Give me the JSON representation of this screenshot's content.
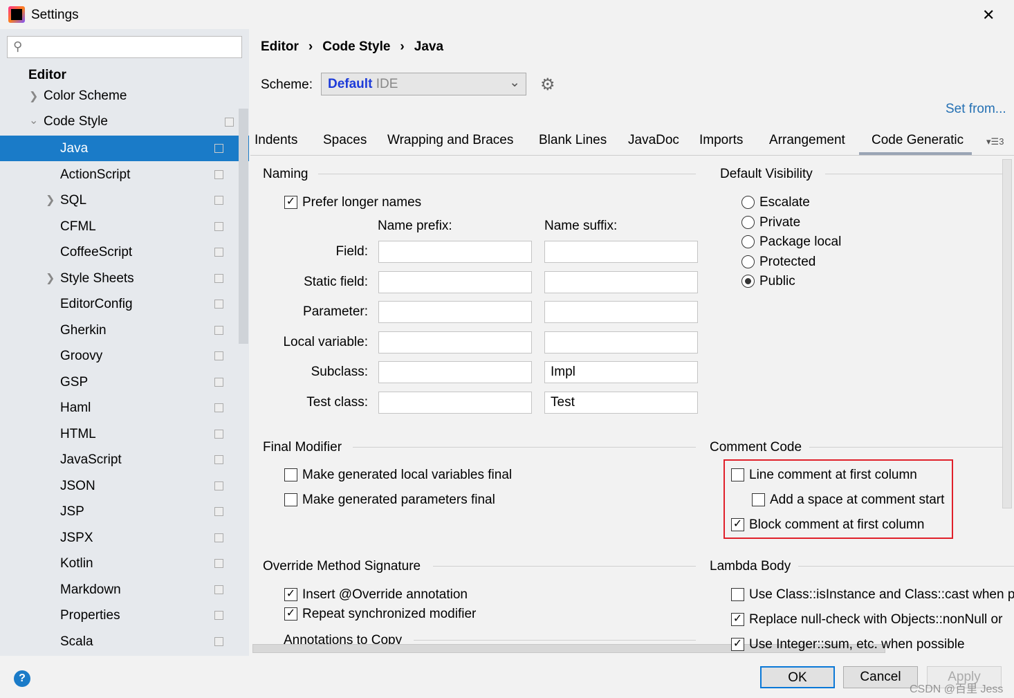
{
  "window": {
    "title": "Settings",
    "close": "✕"
  },
  "search": {
    "placeholder": "",
    "value": ""
  },
  "sidebar": {
    "section": "Editor",
    "color_scheme": "Color Scheme",
    "code_style": "Code Style",
    "items": [
      {
        "label": "Java",
        "selected": true
      },
      {
        "label": "ActionScript"
      },
      {
        "label": "SQL",
        "expandable": true
      },
      {
        "label": "CFML"
      },
      {
        "label": "CoffeeScript"
      },
      {
        "label": "Style Sheets",
        "expandable": true
      },
      {
        "label": "EditorConfig"
      },
      {
        "label": "Gherkin"
      },
      {
        "label": "Groovy"
      },
      {
        "label": "GSP"
      },
      {
        "label": "Haml"
      },
      {
        "label": "HTML"
      },
      {
        "label": "JavaScript"
      },
      {
        "label": "JSON"
      },
      {
        "label": "JSP"
      },
      {
        "label": "JSPX"
      },
      {
        "label": "Kotlin"
      },
      {
        "label": "Markdown"
      },
      {
        "label": "Properties"
      },
      {
        "label": "Scala"
      }
    ]
  },
  "breadcrumb": [
    "Editor",
    "Code Style",
    "Java"
  ],
  "scheme": {
    "label": "Scheme:",
    "name": "Default",
    "type": "IDE",
    "set_from": "Set from..."
  },
  "tabs": [
    "Indents",
    "Spaces",
    "Wrapping and Braces",
    "Blank Lines",
    "JavaDoc",
    "Imports",
    "Arrangement",
    "Code Generatic"
  ],
  "tabs_overflow": "3",
  "active_tab": "Code Generatic",
  "naming": {
    "title": "Naming",
    "prefer_longer": "Prefer longer names",
    "prefix_header": "Name prefix:",
    "suffix_header": "Name suffix:",
    "rows": [
      {
        "label": "Field:",
        "prefix": "",
        "suffix": ""
      },
      {
        "label": "Static field:",
        "prefix": "",
        "suffix": ""
      },
      {
        "label": "Parameter:",
        "prefix": "",
        "suffix": ""
      },
      {
        "label": "Local variable:",
        "prefix": "",
        "suffix": ""
      },
      {
        "label": "Subclass:",
        "prefix": "",
        "suffix": "Impl"
      },
      {
        "label": "Test class:",
        "prefix": "",
        "suffix": "Test"
      }
    ]
  },
  "visibility": {
    "title": "Default Visibility",
    "options": [
      {
        "label": "Escalate"
      },
      {
        "label": "Private"
      },
      {
        "label": "Package local"
      },
      {
        "label": "Protected"
      },
      {
        "label": "Public",
        "selected": true
      }
    ]
  },
  "final_modifier": {
    "title": "Final Modifier",
    "local": "Make generated local variables final",
    "params": "Make generated parameters final"
  },
  "comment_code": {
    "title": "Comment Code",
    "line": "Line comment at first column",
    "space": "Add a space at comment start",
    "block": "Block comment at first column"
  },
  "override": {
    "title": "Override Method Signature",
    "insert": "Insert @Override annotation",
    "repeat": "Repeat synchronized modifier",
    "annotations": "Annotations to Copy"
  },
  "lambda": {
    "title": "Lambda Body",
    "isinstance": "Use Class::isInstance and Class::cast when pos",
    "nonnull": "Replace null-check with Objects::nonNull or",
    "sum": "Use Integer::sum, etc. when possible"
  },
  "buttons": {
    "ok": "OK",
    "cancel": "Cancel",
    "apply": "Apply"
  },
  "watermark": "CSDN @百里 Jess",
  "colors": {
    "accent": "#1a7bc8",
    "highlight_box": "#e0202a",
    "link": "#2470b3"
  }
}
